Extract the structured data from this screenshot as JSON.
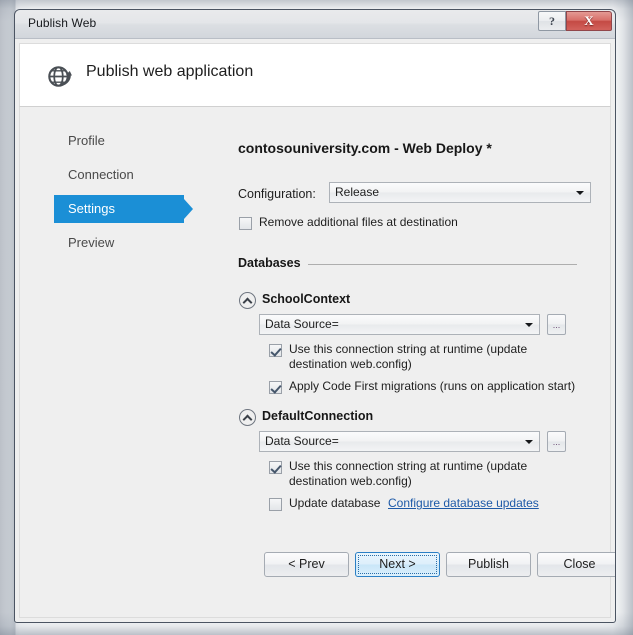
{
  "window": {
    "title": "Publish Web",
    "help_button_glyph": "?",
    "close_button_glyph": "X"
  },
  "header": {
    "icon": "globe-publish-icon",
    "title": "Publish web application"
  },
  "sidebar": {
    "items": [
      {
        "label": "Profile",
        "active": false
      },
      {
        "label": "Connection",
        "active": false
      },
      {
        "label": "Settings",
        "active": true
      },
      {
        "label": "Preview",
        "active": false
      }
    ]
  },
  "settings": {
    "profile_heading": "contosouniversity.com - Web Deploy *",
    "configuration_label": "Configuration:",
    "configuration_value": "Release",
    "remove_files_label": "Remove additional files at destination",
    "remove_files_checked": false,
    "databases_label": "Databases",
    "browse_button_label": "...",
    "databases": [
      {
        "name": "SchoolContext",
        "connection_value": "Data Source=",
        "options": [
          {
            "label": "Use this connection string at runtime (update destination web.config)",
            "checked": true
          },
          {
            "label": "Apply Code First migrations (runs on application start)",
            "checked": true
          }
        ]
      },
      {
        "name": "DefaultConnection",
        "connection_value": "Data Source=",
        "options": [
          {
            "label": "Use this connection string at runtime (update destination web.config)",
            "checked": true
          },
          {
            "label": "Update database",
            "checked": false
          }
        ],
        "link_label": "Configure database updates"
      }
    ]
  },
  "footer": {
    "prev_label": "< Prev",
    "next_label": "Next >",
    "publish_label": "Publish",
    "close_label": "Close"
  },
  "colors": {
    "accent_blue": "#1b8fd6",
    "link_blue": "#1e5aa8",
    "close_red": "#c44a44",
    "body_gray": "#efefef"
  }
}
